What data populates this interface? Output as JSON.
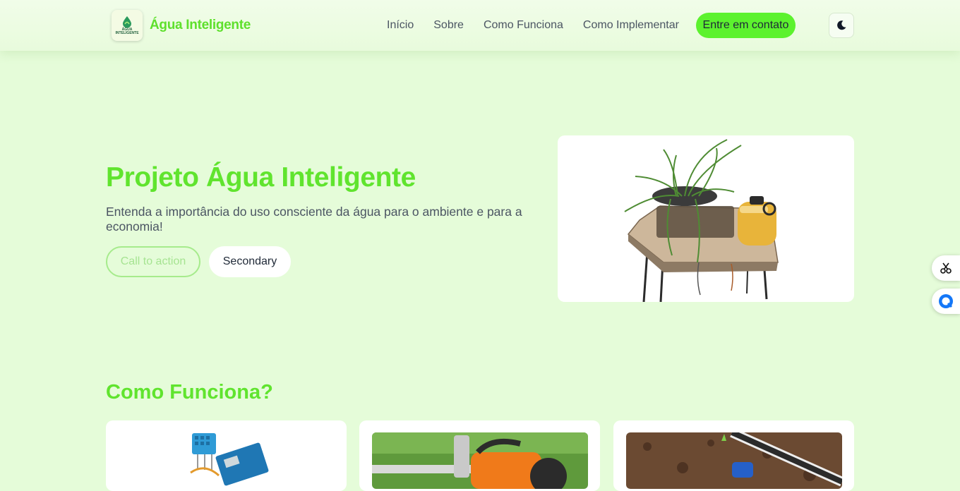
{
  "brand": {
    "name": "Água Inteligente",
    "logo_line1": "ÁGUA",
    "logo_line2": "INTELIGENTE"
  },
  "nav": {
    "links": [
      "Início",
      "Sobre",
      "Como Funciona",
      "Como Implementar"
    ],
    "cta": "Entre em contato",
    "theme_icon": "moon-icon"
  },
  "hero": {
    "title": "Projeto Água Inteligente",
    "subtitle": "Entenda a importância do uso consciente da água para o ambiente e para a economia!",
    "primary_button": "Call to action",
    "secondary_button": "Secondary"
  },
  "section": {
    "title": "Como Funciona?"
  },
  "side_tools": [
    "scissors-icon",
    "chat-bubble-icon"
  ],
  "colors": {
    "accent": "#5ef22e",
    "title_green": "#60e42e",
    "background": "#e5fcd9"
  }
}
